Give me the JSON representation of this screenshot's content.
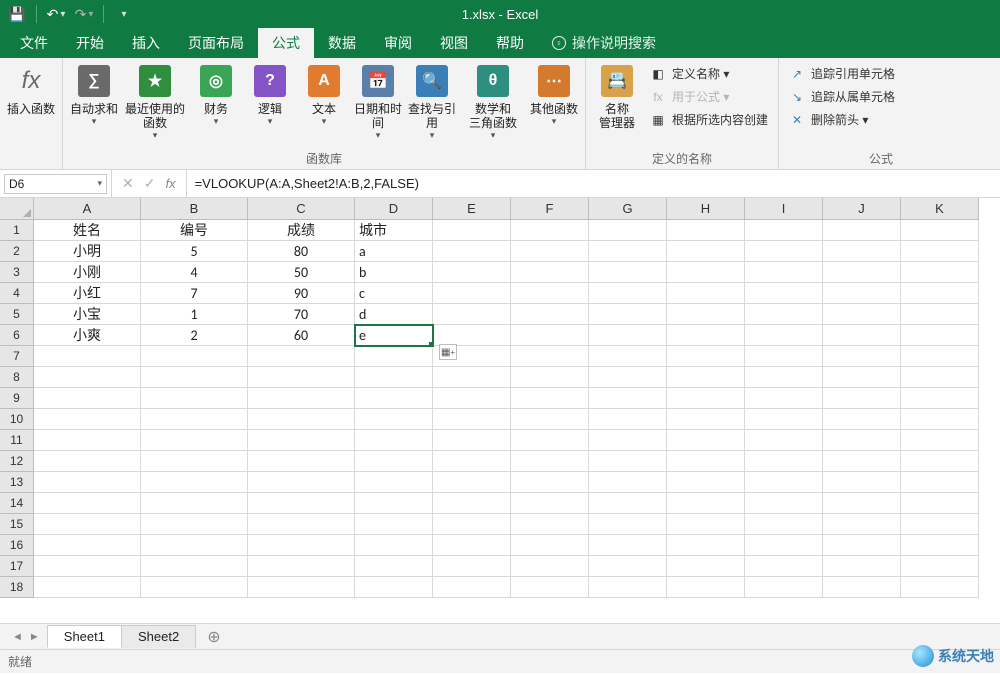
{
  "app": {
    "title": "1.xlsx  -  Excel"
  },
  "qat": {
    "save": "save-icon",
    "undo": "undo-icon",
    "redo": "redo-icon"
  },
  "menu": {
    "tabs": [
      "文件",
      "开始",
      "插入",
      "页面布局",
      "公式",
      "数据",
      "审阅",
      "视图",
      "帮助"
    ],
    "active_index": 4,
    "tell_me": "操作说明搜索"
  },
  "ribbon": {
    "insert_fn": "插入函数",
    "library": {
      "label": "函数库",
      "items": [
        {
          "label": "自动求和",
          "sub": "▾",
          "color": "#6a6a6a",
          "glyph": "∑"
        },
        {
          "label": "最近使用的\n函数",
          "sub": "▾",
          "color": "#2f8f3f",
          "glyph": "★"
        },
        {
          "label": "财务",
          "sub": "▾",
          "color": "#3aa655",
          "glyph": "◎"
        },
        {
          "label": "逻辑",
          "sub": "▾",
          "color": "#8453c5",
          "glyph": "?"
        },
        {
          "label": "文本",
          "sub": "▾",
          "color": "#e07b2f",
          "glyph": "A"
        },
        {
          "label": "日期和时间",
          "sub": "▾",
          "color": "#5a7fa8",
          "glyph": "📅"
        },
        {
          "label": "查找与引用",
          "sub": "▾",
          "color": "#3a7fb8",
          "glyph": "🔍"
        },
        {
          "label": "数学和\n三角函数",
          "sub": "▾",
          "color": "#2f8f7f",
          "glyph": "θ"
        },
        {
          "label": "其他函数",
          "sub": "▾",
          "color": "#d47a2f",
          "glyph": "⋯"
        }
      ]
    },
    "defined_names": {
      "label": "定义的名称",
      "manager": "名称\n管理器",
      "items": [
        "定义名称 ▾",
        "用于公式 ▾",
        "根据所选内容创建"
      ]
    },
    "audit": {
      "label": "公式",
      "items": [
        "追踪引用单元格",
        "追踪从属单元格",
        "删除箭头 ▾"
      ]
    }
  },
  "formula_bar": {
    "namebox": "D6",
    "formula": "=VLOOKUP(A:A,Sheet2!A:B,2,FALSE)"
  },
  "grid": {
    "columns": [
      "A",
      "B",
      "C",
      "D",
      "E",
      "F",
      "G",
      "H",
      "I",
      "J",
      "K"
    ],
    "rows": 18,
    "data": [
      [
        "姓名",
        "编号",
        "成绩",
        "城市",
        "",
        "",
        "",
        "",
        "",
        "",
        ""
      ],
      [
        "小明",
        "5",
        "80",
        "a",
        "",
        "",
        "",
        "",
        "",
        "",
        ""
      ],
      [
        "小刚",
        "4",
        "50",
        "b",
        "",
        "",
        "",
        "",
        "",
        "",
        ""
      ],
      [
        "小红",
        "7",
        "90",
        "c",
        "",
        "",
        "",
        "",
        "",
        "",
        ""
      ],
      [
        "小宝",
        "1",
        "70",
        "d",
        "",
        "",
        "",
        "",
        "",
        "",
        ""
      ],
      [
        "小爽",
        "2",
        "60",
        "e",
        "",
        "",
        "",
        "",
        "",
        "",
        ""
      ]
    ],
    "align": {
      "A": "center",
      "B": "center",
      "C": "center",
      "D": "left"
    },
    "selected": {
      "row": 6,
      "col": 4
    }
  },
  "sheets": {
    "tabs": [
      "Sheet1",
      "Sheet2"
    ],
    "active_index": 0
  },
  "status": {
    "text": "就绪"
  },
  "watermark": "系统天地"
}
